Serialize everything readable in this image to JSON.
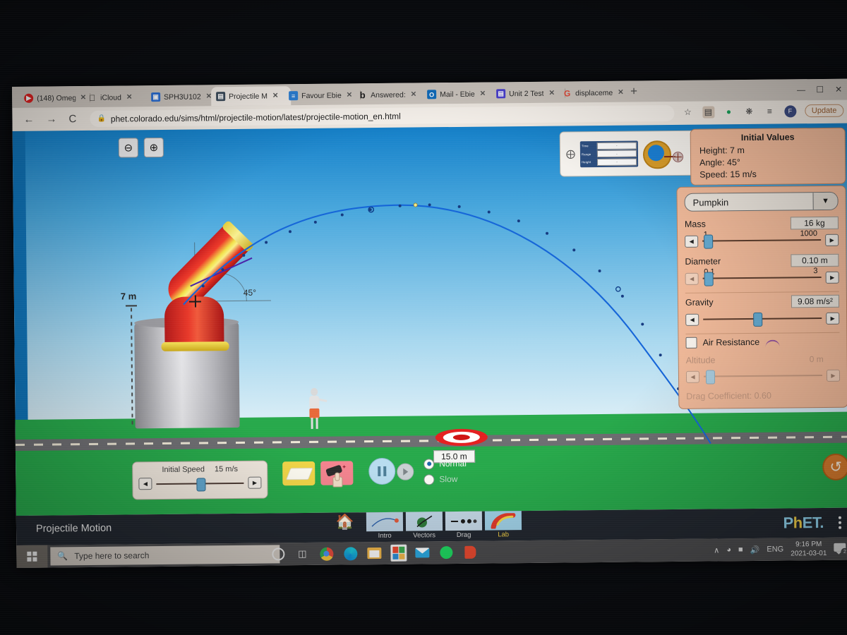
{
  "browser": {
    "tabs": [
      {
        "title": "(148) Omeg",
        "favicon": "youtube-icon",
        "color": "#e02020",
        "active": false
      },
      {
        "title": "iCloud",
        "favicon": "apple-icon",
        "color": "#2b2b2b",
        "active": false
      },
      {
        "title": "SPH3U102",
        "favicon": "classroom-icon",
        "color": "#2b6fd6",
        "active": false
      },
      {
        "title": "Projectile M",
        "favicon": "phet-icon",
        "color": "#3a4a5a",
        "active": true
      },
      {
        "title": "Favour Ebie",
        "favicon": "docs-icon",
        "color": "#2b7fd6",
        "active": false
      },
      {
        "title": "Answered:",
        "favicon": "brainly-icon",
        "color": "#1b1b1b",
        "active": false
      },
      {
        "title": "Mail - Ebie",
        "favicon": "outlook-icon",
        "color": "#0f6cbd",
        "active": false
      },
      {
        "title": "Unit 2 Test",
        "favicon": "forms-icon",
        "color": "#4a3fd0",
        "active": false
      },
      {
        "title": "displaceme",
        "favicon": "google-icon",
        "color": "#e04a3a",
        "active": false
      }
    ],
    "new_tab_label": "+",
    "window_controls": [
      "minimize",
      "maximize",
      "close"
    ],
    "nav": {
      "back": "←",
      "forward": "→",
      "reload": "C"
    },
    "url": "phet.colorado.edu/sims/html/projectile-motion/latest/projectile-motion_en.html",
    "lock_icon": "lock-icon",
    "omnibox_icons": [
      "star-icon",
      "reading-list-icon",
      "grammarly-icon",
      "extensions-icon",
      "media-list-icon",
      "profile-icon"
    ],
    "profile_initial": "F",
    "update_label": "Update"
  },
  "sim": {
    "zoom_out_icon": "zoom-out-icon",
    "zoom_in_icon": "zoom-in-icon",
    "tools": {
      "data_rows": [
        {
          "label": "Time",
          "value": "-"
        },
        {
          "label": "Range",
          "value": "-"
        },
        {
          "label": "Height",
          "value": "-"
        }
      ],
      "tape_measure_icon": "measuring-tape-icon",
      "crosshair_icon": "crosshair-icon"
    },
    "cannon": {
      "height_label": "7 m",
      "angle_label": "45°"
    },
    "target": {
      "distance_label": "15.0 m"
    },
    "initial_speed": {
      "label": "Initial Speed",
      "value": "15 m/s"
    },
    "buttons": {
      "eraser": "eraser-icon",
      "fire": "fire-cannon-icon",
      "pause": "pause-icon",
      "step": "step-forward-icon",
      "reset_all": "reset-all-icon"
    },
    "speed_radios": [
      {
        "label": "Normal",
        "selected": true
      },
      {
        "label": "Slow",
        "selected": false
      }
    ]
  },
  "initial_values": {
    "title": "Initial Values",
    "lines": [
      "Height: 7 m",
      "Angle: 45°",
      "Speed: 15 m/s"
    ]
  },
  "projectile_panel": {
    "selected_projectile": "Pumpkin",
    "dropdown_icon": "chevron-down-icon",
    "controls": [
      {
        "name": "Mass",
        "value": "16 kg",
        "min": "1",
        "max": "1000",
        "knob_pct": 3,
        "enabled": true,
        "show_ticks": true
      },
      {
        "name": "Diameter",
        "value": "0.10 m",
        "min": "0.1",
        "max": "3",
        "knob_pct": 3,
        "enabled": true,
        "show_ticks": true
      },
      {
        "name": "Gravity",
        "value": "9.08 m/s²",
        "min": "",
        "max": "",
        "knob_pct": 44,
        "enabled": true,
        "show_ticks": false
      }
    ],
    "air_resistance": {
      "label": "Air Resistance",
      "checked": false,
      "icon": "drag-arc-icon"
    },
    "altitude": {
      "name": "Altitude",
      "value": "0 m",
      "knob_pct": 4,
      "enabled": false
    },
    "drag_coefficient": "Drag Coefficient: 0.60"
  },
  "phet_navbar": {
    "sim_title": "Projectile Motion",
    "home_icon": "home-icon",
    "tabs": [
      {
        "label": "Intro",
        "thumb": "intro-thumb",
        "selected": false
      },
      {
        "label": "Vectors",
        "thumb": "vectors-thumb",
        "selected": false
      },
      {
        "label": "Drag",
        "thumb": "drag-thumb",
        "selected": false
      },
      {
        "label": "Lab",
        "thumb": "lab-thumb",
        "selected": true
      }
    ],
    "logo": {
      "part1": "P",
      "part2": "h",
      "part3": "ET",
      "dot": "."
    },
    "menu_icon": "kebab-menu-icon"
  },
  "taskbar": {
    "start_icon": "windows-start-icon",
    "search_placeholder": "Type here to search",
    "search_icon": "search-icon",
    "items": [
      {
        "name": "cortana-icon"
      },
      {
        "name": "task-view-icon"
      },
      {
        "name": "chrome-icon"
      },
      {
        "name": "edge-icon"
      },
      {
        "name": "file-explorer-icon"
      },
      {
        "name": "microsoft-store-icon"
      },
      {
        "name": "mail-icon"
      },
      {
        "name": "spotify-icon"
      },
      {
        "name": "office-icon"
      }
    ],
    "tray": {
      "chevron": "∧",
      "wifi_icon": "wifi-icon",
      "battery_icon": "battery-icon",
      "volume_icon": "volume-icon",
      "language": "ENG",
      "time": "9:16 PM",
      "date": "2021-03-01",
      "notification_icon": "notifications-icon",
      "notification_count": "2"
    }
  }
}
